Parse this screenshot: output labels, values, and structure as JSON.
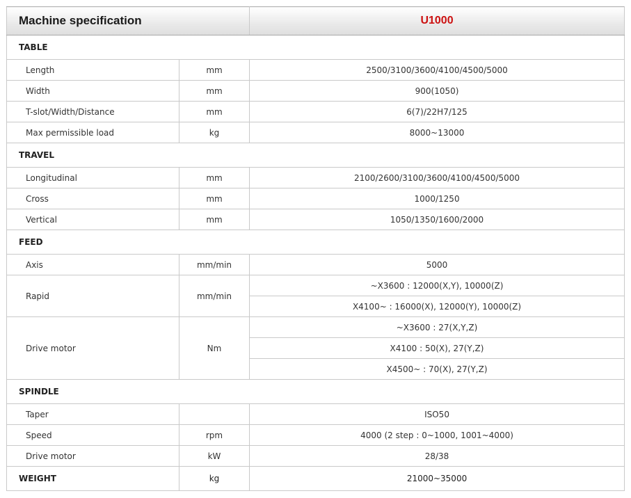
{
  "header": {
    "title": "Machine specification",
    "model": "U1000"
  },
  "sections": {
    "table": {
      "label": "TABLE",
      "length": {
        "name": "Length",
        "unit": "mm",
        "value": "2500/3100/3600/4100/4500/5000"
      },
      "width": {
        "name": "Width",
        "unit": "mm",
        "value": "900(1050)"
      },
      "tslot": {
        "name": "T-slot/Width/Distance",
        "unit": "mm",
        "value": "6(7)/22H7/125"
      },
      "load": {
        "name": "Max permissible load",
        "unit": "kg",
        "value": "8000~13000"
      }
    },
    "travel": {
      "label": "TRAVEL",
      "longitudinal": {
        "name": "Longitudinal",
        "unit": "mm",
        "value": "2100/2600/3100/3600/4100/4500/5000"
      },
      "cross": {
        "name": "Cross",
        "unit": "mm",
        "value": "1000/1250"
      },
      "vertical": {
        "name": "Vertical",
        "unit": "mm",
        "value": "1050/1350/1600/2000"
      }
    },
    "feed": {
      "label": "FEED",
      "axis": {
        "name": "Axis",
        "unit": "mm/min",
        "value": "5000"
      },
      "rapid": {
        "name": "Rapid",
        "unit": "mm/min",
        "values": [
          "~X3600 : 12000(X,Y), 10000(Z)",
          "X4100~ : 16000(X), 12000(Y), 10000(Z)"
        ]
      },
      "drive": {
        "name": "Drive motor",
        "unit": "Nm",
        "values": [
          "~X3600 : 27(X,Y,Z)",
          "X4100 : 50(X), 27(Y,Z)",
          "X4500~ : 70(X), 27(Y,Z)"
        ]
      }
    },
    "spindle": {
      "label": "SPINDLE",
      "taper": {
        "name": "Taper",
        "unit": "",
        "value": "ISO50"
      },
      "speed": {
        "name": "Speed",
        "unit": "rpm",
        "value": "4000 (2 step : 0~1000, 1001~4000)"
      },
      "drive": {
        "name": "Drive motor",
        "unit": "kW",
        "value": "28/38"
      }
    },
    "weight": {
      "label": "WEIGHT",
      "unit": "kg",
      "value": "21000~35000"
    }
  }
}
